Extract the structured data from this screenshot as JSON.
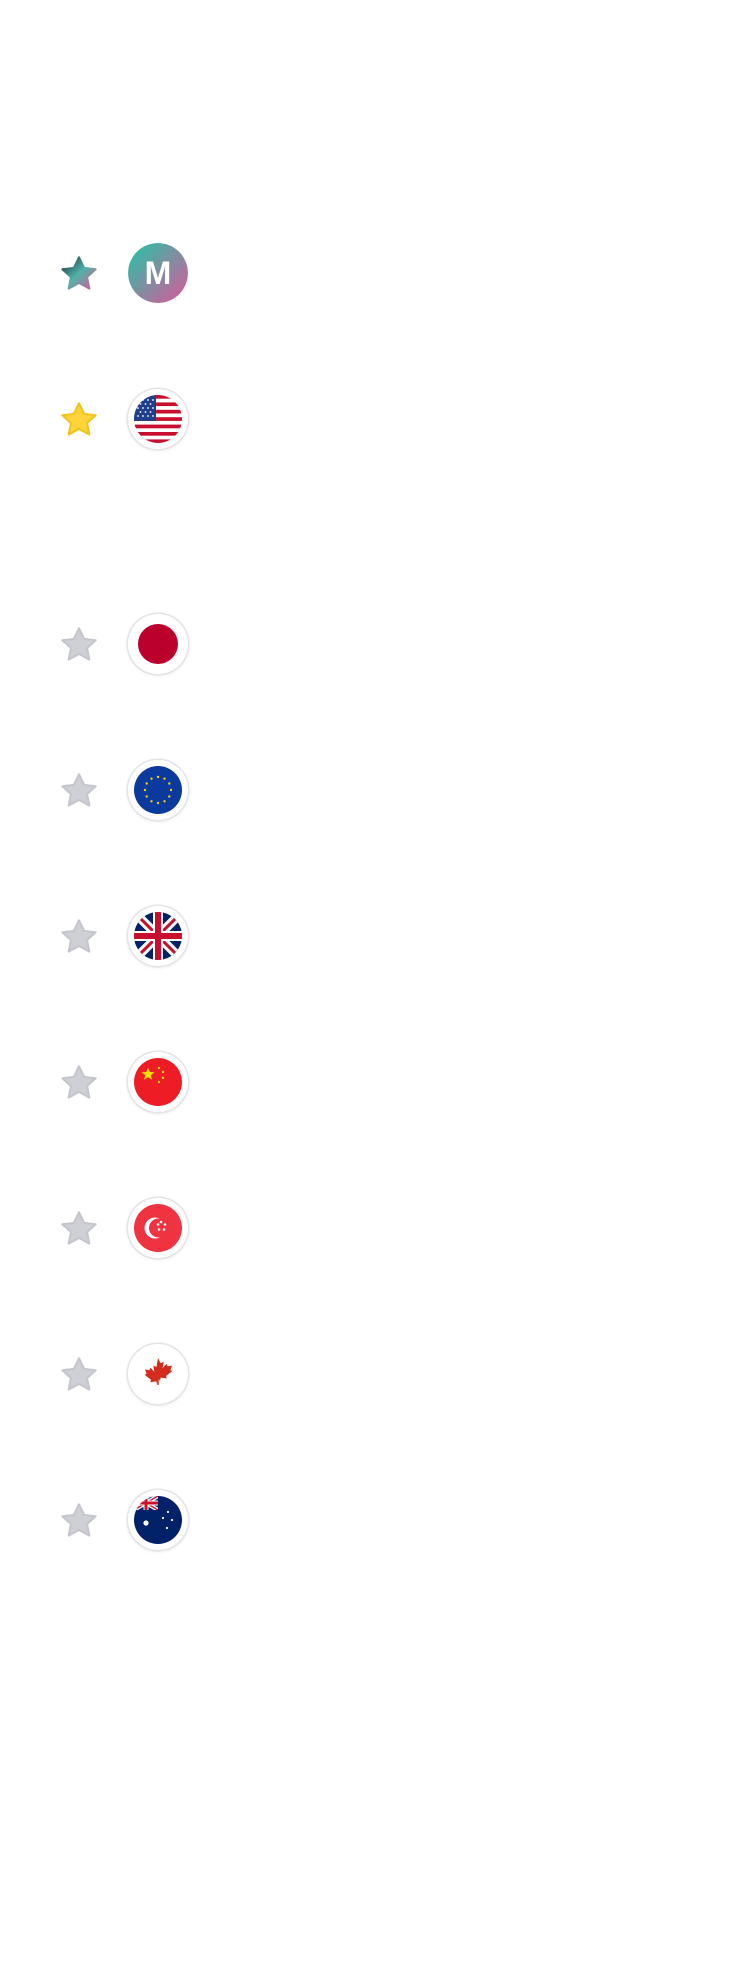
{
  "brand": {
    "letter": "M",
    "icon": "m-brand-logo"
  },
  "rows": [
    {
      "name": "brand",
      "favorite": "gradient",
      "icon": "m-brand-logo"
    },
    {
      "name": "usa",
      "favorite": "active",
      "icon": "us-flag-icon"
    },
    {
      "name": "japan",
      "favorite": "inactive",
      "icon": "japan-flag-icon"
    },
    {
      "name": "european-union",
      "favorite": "inactive",
      "icon": "eu-flag-icon"
    },
    {
      "name": "united-kingdom",
      "favorite": "inactive",
      "icon": "uk-flag-icon"
    },
    {
      "name": "china",
      "favorite": "inactive",
      "icon": "china-flag-icon"
    },
    {
      "name": "singapore",
      "favorite": "inactive",
      "icon": "singapore-flag-icon"
    },
    {
      "name": "canada",
      "favorite": "inactive",
      "icon": "canada-flag-icon"
    },
    {
      "name": "australia",
      "favorite": "inactive",
      "icon": "australia-flag-icon"
    }
  ],
  "colors": {
    "star_active": "#FFD43B",
    "star_inactive": "#CFCFD6",
    "brand_gradient": [
      "#1FC7A8",
      "#E0559A"
    ]
  }
}
